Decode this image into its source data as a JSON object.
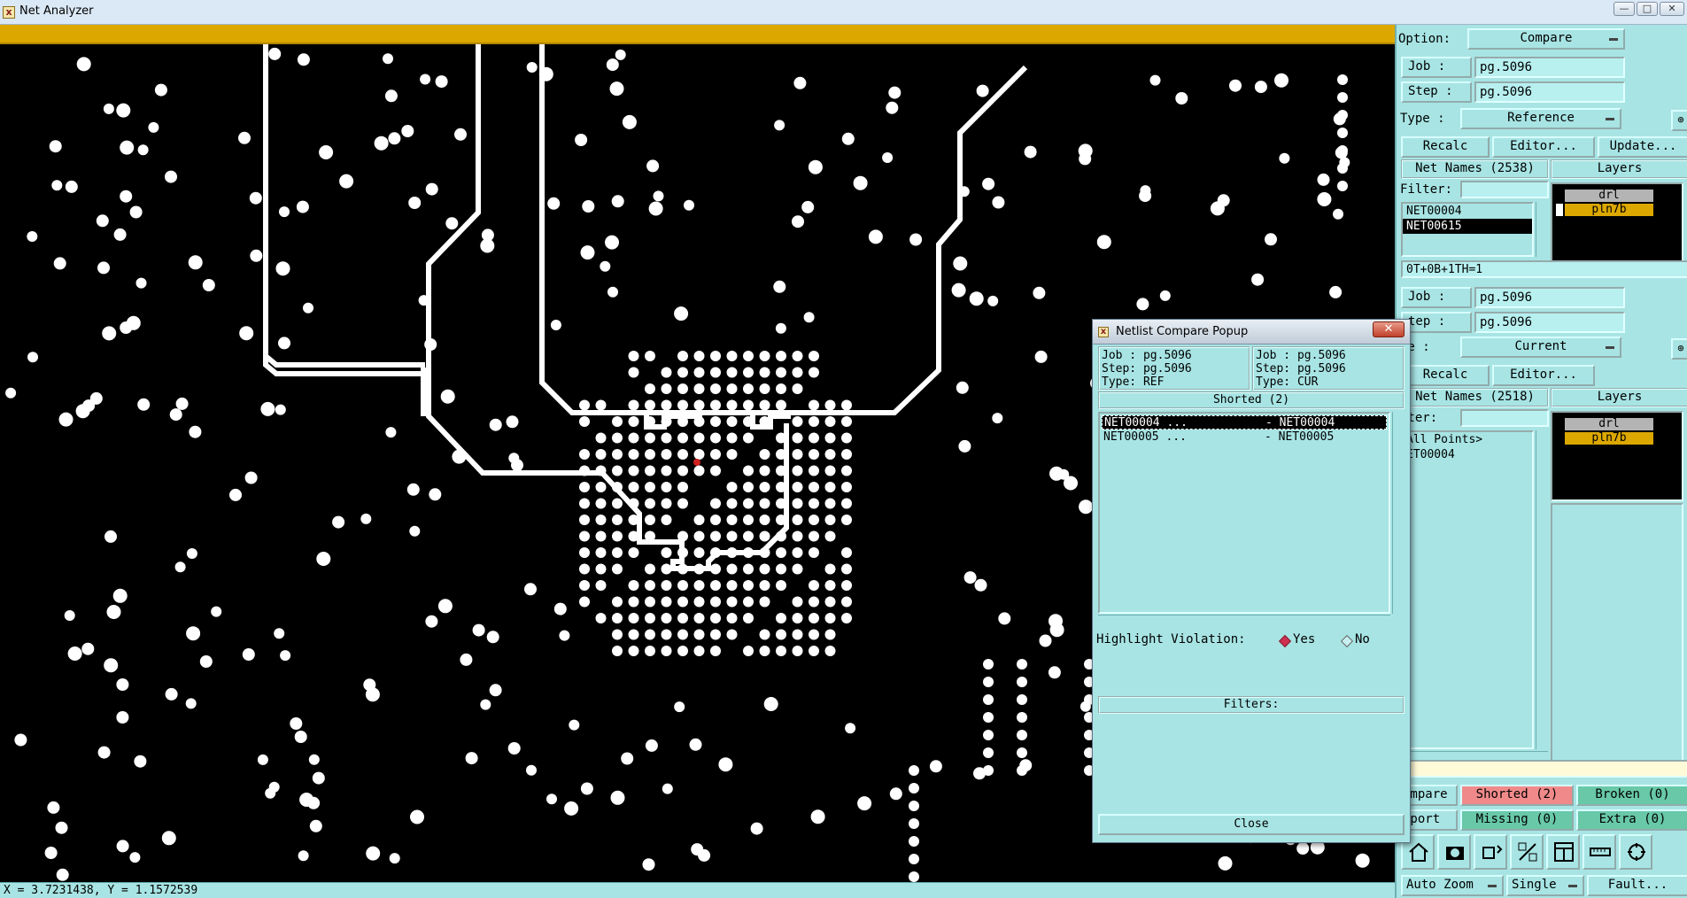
{
  "window": {
    "title": "Net Analyzer",
    "icon": "app-x-icon",
    "controls": [
      "minimize-icon",
      "maximize-icon",
      "close-icon"
    ]
  },
  "status": {
    "coords": "X = 3.7231438, Y = 1.1572539"
  },
  "colors": {
    "canvas_bg": "#000000",
    "pcb_feature": "#ffffff",
    "header_bar": "#dca800",
    "panel_bg": "#a8e4e4",
    "shorted_bg": "#f08a8a",
    "broken_bg": "#68c8a8",
    "layer_highlight": "#dca800",
    "layer_drl": "#b4b4b4"
  },
  "panel": {
    "option_label": "Option:",
    "option_value": "Compare",
    "ref": {
      "job_label": "Job  :",
      "job_value": "pg.5096",
      "step_label": "Step :",
      "step_value": "pg.5096",
      "type_label": "Type :",
      "type_value": "Reference",
      "recalc": "Recalc",
      "editor": "Editor...",
      "update": "Update...",
      "net_names": "Net Names (2538)",
      "layers_hdr": "Layers",
      "filter_label": "Filter:",
      "nets": [
        "NET00004",
        "NET00615"
      ],
      "layers": [
        "drl",
        "pln7b"
      ],
      "formula": "0T+0B+1TH=1"
    },
    "cur": {
      "job_label": "Job  :",
      "job_value": "pg.5096",
      "step_label": "tep :",
      "step_value": "pg.5096",
      "type_label": "pe :",
      "type_value": "Current",
      "recalc": "Recalc",
      "editor": "Editor...",
      "net_names": "Net Names (2518)",
      "layers_hdr": "Layers",
      "filter_label": "lter:",
      "nets": [
        "All Points>",
        "ET00004"
      ],
      "layers": [
        "drl",
        "pln7b"
      ]
    },
    "results": {
      "compare": "ompare",
      "shorted": "Shorted (2)",
      "broken": "Broken (0)",
      "report": "eport",
      "missing": "Missing (0)",
      "extra": "Extra (0)"
    },
    "tools": [
      "home-icon",
      "camera-icon",
      "undo-zoom-icon",
      "probe-icon",
      "window-icon",
      "ruler-icon",
      "tool-settings-icon"
    ],
    "bottom": {
      "auto_zoom": "Auto Zoom",
      "single": "Single",
      "fault": "Fault..."
    }
  },
  "popup": {
    "title": "Netlist Compare Popup",
    "ref": {
      "job": "Job : pg.5096",
      "step": "Step: pg.5096",
      "type": "Type: REF"
    },
    "cur": {
      "job": "Job : pg.5096",
      "step": "Step: pg.5096",
      "type": "Type: CUR"
    },
    "section": "Shorted (2)",
    "rows": [
      {
        "left": "NET00004 ...",
        "right": "- NET00004"
      },
      {
        "left": "NET00005 ...",
        "right": "- NET00005"
      }
    ],
    "highlight_label": "Highlight Violation:",
    "yes": "Yes",
    "no": "No",
    "filters": "Filters:",
    "close": "Close"
  }
}
